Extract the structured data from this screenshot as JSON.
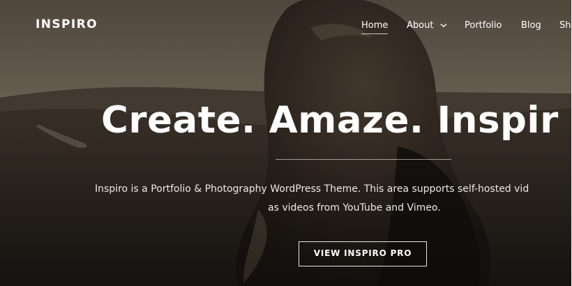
{
  "site": {
    "logo": "INSPIRO"
  },
  "nav": {
    "items": [
      {
        "label": "Home",
        "active": true
      },
      {
        "label": "About",
        "dropdown": true,
        "icon": "chevron-down-icon"
      },
      {
        "label": "Portfolio"
      },
      {
        "label": "Blog"
      },
      {
        "label": "Sh"
      }
    ]
  },
  "hero": {
    "headline": "Create. Amaze. Inspir",
    "description_line1": "Inspiro is a Portfolio & Photography WordPress Theme. This area supports self-hosted vid",
    "description_line2": "as videos from YouTube and Vimeo.",
    "cta_label": "VIEW INSPIRO PRO",
    "background": "photo of a woman with long hair in a hilly landscape (sepia, dark overlay)"
  },
  "colors": {
    "overlay_dark": "#1f1a15",
    "sky": "#6f6558",
    "hills": "#3a3128",
    "text": "#ffffff"
  }
}
